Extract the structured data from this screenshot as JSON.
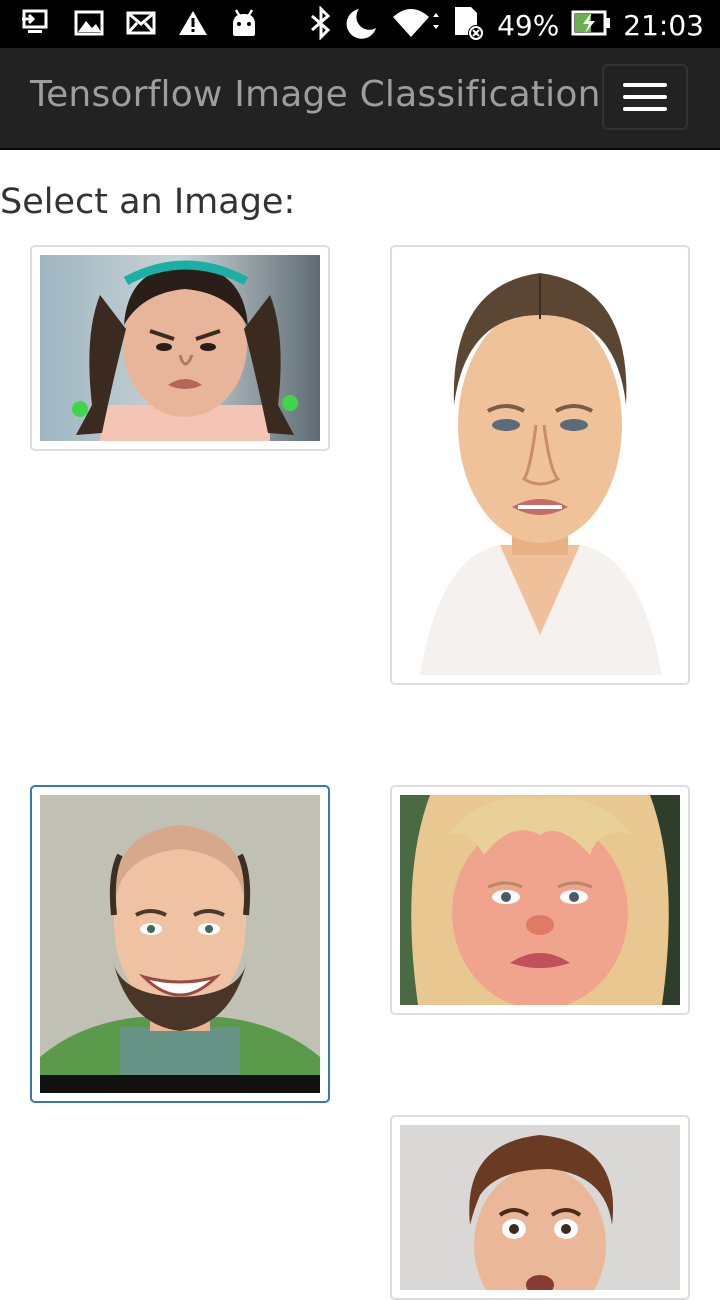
{
  "status_bar": {
    "battery": "49%",
    "time": "21:03",
    "icons": [
      "usb-debug-icon",
      "image-icon",
      "mail-icon",
      "warning-icon",
      "android-icon",
      "bluetooth-icon",
      "do-not-disturb-moon-icon",
      "wifi-icon",
      "sd-card-error-icon",
      "battery-charging-icon"
    ]
  },
  "navbar": {
    "title": "Tensorflow Image Classification",
    "menu_icon": "hamburger-menu-icon"
  },
  "main": {
    "heading": "Select an Image:",
    "images": [
      {
        "name": "thumb-girl-angry",
        "selected": false
      },
      {
        "name": "thumb-woman-disgust",
        "selected": false
      },
      {
        "name": "thumb-man-smiling",
        "selected": true
      },
      {
        "name": "thumb-girl-sad",
        "selected": false
      },
      {
        "name": "thumb-boy-surprised",
        "selected": false
      }
    ]
  },
  "colors": {
    "navbar_bg": "#222222",
    "brand_text": "#9d9d9d",
    "selected_border": "#337ab7"
  }
}
